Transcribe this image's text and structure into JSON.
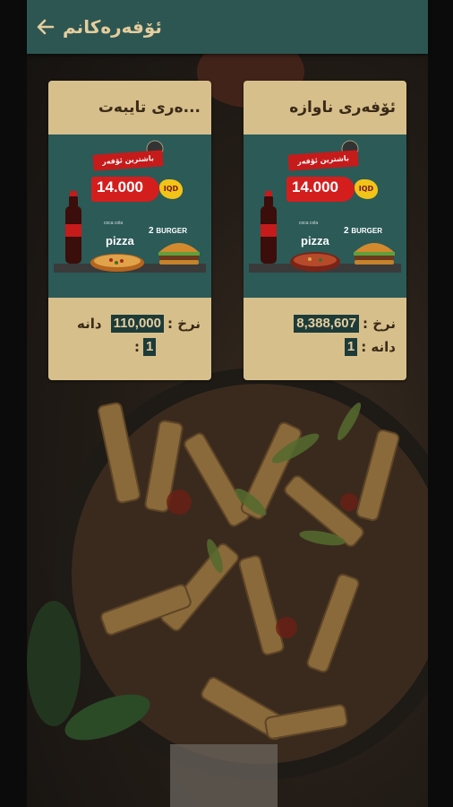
{
  "app": {
    "title": "ئۆفەرەکانم",
    "back_icon": "arrow-left-icon",
    "header_color": "#2d5652",
    "accent_color": "#e4cd9d",
    "card_color": "#d7bf8b"
  },
  "offers": [
    {
      "title": "...ەری تایبەت",
      "promo": {
        "badge": "باشترین ئۆفەر",
        "price": "14.000",
        "currency": "IQD",
        "pizza": "pizza",
        "burger_count": "2",
        "burger_text": "BURGER",
        "cola": "coca cola"
      },
      "price_label": "نرخ :",
      "price_value": "110,000",
      "qty_label": "دانە",
      "qty_value": "1",
      "qty_colon": ":"
    },
    {
      "title": "ئۆفەری ناوازە",
      "promo": {
        "badge": "باشترین ئۆفەر",
        "price": "14.000",
        "currency": "IQD",
        "pizza": "pizza",
        "burger_count": "2",
        "burger_text": "BURGER",
        "cola": "coca cola"
      },
      "price_label": "نرخ :",
      "price_value": "8,388,607",
      "qty_label": "دانە :",
      "qty_value": "1"
    }
  ]
}
